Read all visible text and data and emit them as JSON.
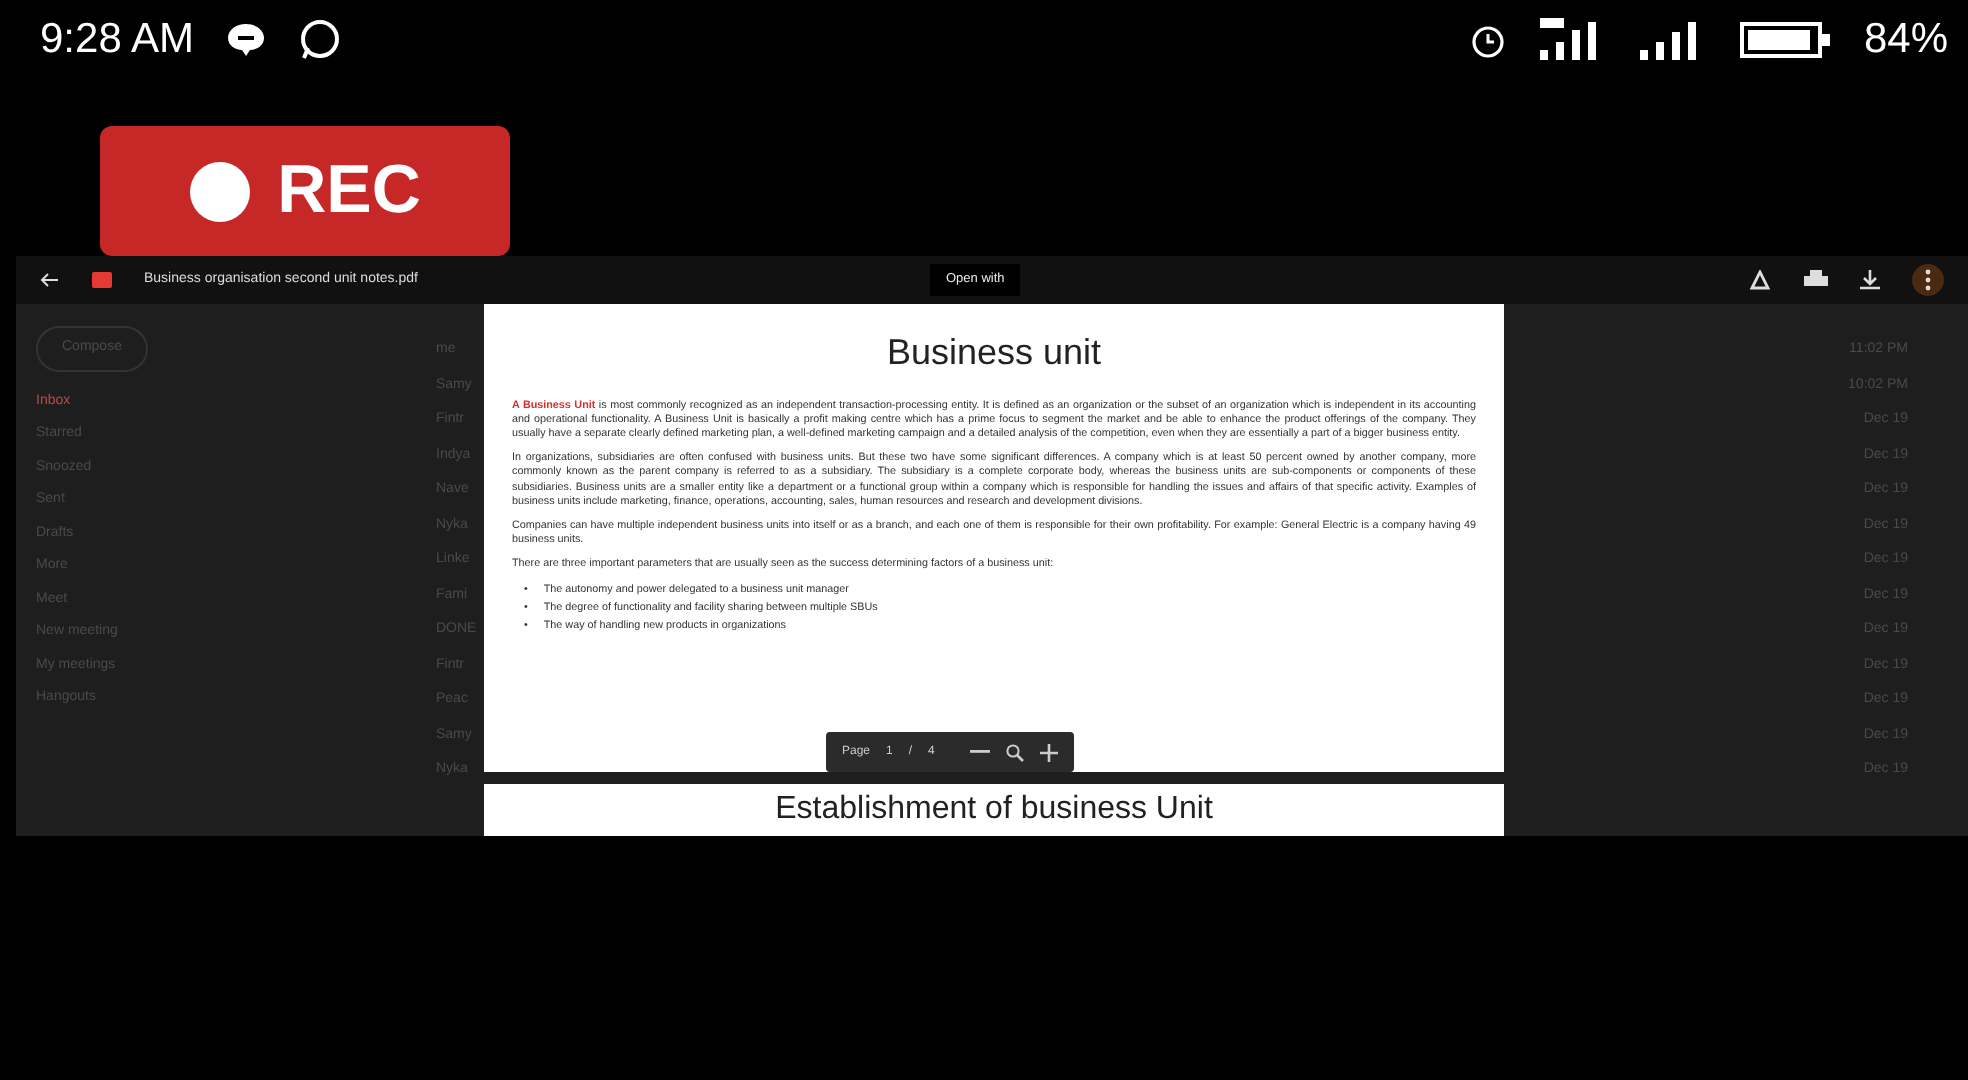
{
  "status_bar": {
    "time": "9:28 AM",
    "battery_percent": "84%"
  },
  "recorder": {
    "label": "REC"
  },
  "viewer": {
    "file_name": "Business organisation second unit notes.pdf",
    "open_with": "Open with",
    "background_mail": {
      "compose": "Compose",
      "nav": [
        {
          "label": "Inbox",
          "selected": true
        },
        {
          "label": "Starred",
          "selected": false
        },
        {
          "label": "Snoozed",
          "selected": false
        },
        {
          "label": "Sent",
          "selected": false
        },
        {
          "label": "Drafts",
          "selected": false
        },
        {
          "label": "More",
          "selected": false
        }
      ],
      "meet_heading": "Meet",
      "meet_items": [
        "New meeting",
        "My meetings"
      ],
      "hangouts_heading": "Hangouts",
      "mails": [
        {
          "sender": "me",
          "date": "11:02 PM"
        },
        {
          "sender": "Samy",
          "date": "10:02 PM"
        },
        {
          "sender": "Fintr",
          "date": "Dec 19"
        },
        {
          "sender": "Indya",
          "date": "Dec 19"
        },
        {
          "sender": "Nave",
          "date": "Dec 19"
        },
        {
          "sender": "Nyka",
          "date": "Dec 19"
        },
        {
          "sender": "Linke",
          "date": "Dec 19"
        },
        {
          "sender": "Fami",
          "date": "Dec 19"
        },
        {
          "sender": "DONE",
          "date": "Dec 19"
        },
        {
          "sender": "Fintr",
          "date": "Dec 19"
        },
        {
          "sender": "Peac",
          "date": "Dec 19"
        },
        {
          "sender": "Samy",
          "date": "Dec 19"
        },
        {
          "sender": "Nyka",
          "date": "Dec 19"
        }
      ]
    },
    "pdf_page": {
      "title": "Business unit",
      "paragraphs": [
        "**A Business Unit** is most commonly recognized as an independent transaction-processing entity. It is defined as an organization or the subset of an organization which is independent in its accounting and operational functionality. A Business Unit is basically a profit making centre which has a prime focus to segment the market and be able to enhance the product offerings of the company. They usually have a separate clearly defined marketing plan, a well-defined marketing campaign and a detailed analysis of the competition, even when they are essentially a part of a bigger business entity.",
        "In organizations, subsidiaries are often confused with business units. But these two have some significant differences. A company which is at least 50 percent owned by another company, more commonly known as the parent company is referred to as a subsidiary. The subsidiary is a complete corporate body, whereas the business units are sub-components or components of these subsidiaries. Business units are a smaller entity like a department or a functional group within a company which is responsible for handling the issues and affairs of that specific activity. Examples of business units include marketing, finance, operations, accounting, sales, human resources and research and development divisions.",
        "Companies can have multiple independent business units into itself or as a branch, and each one of them is responsible for their own profitability. For example: General Electric is a company having 49 business units.",
        "There are three important parameters that are usually seen as the success determining factors of a business unit:"
      ],
      "bullets": [
        {
          "marker": "•",
          "text": "The autonomy and power delegated to a business unit manager"
        },
        {
          "marker": "•",
          "text": "The degree of functionality and facility sharing between multiple SBUs"
        },
        {
          "marker": "•",
          "text": "The way of handling new products in organizations"
        }
      ]
    },
    "next_page_heading": "Establishment of business Unit",
    "page_controls": {
      "label": "Page",
      "current": "1",
      "separator": "/",
      "total": "4"
    }
  }
}
